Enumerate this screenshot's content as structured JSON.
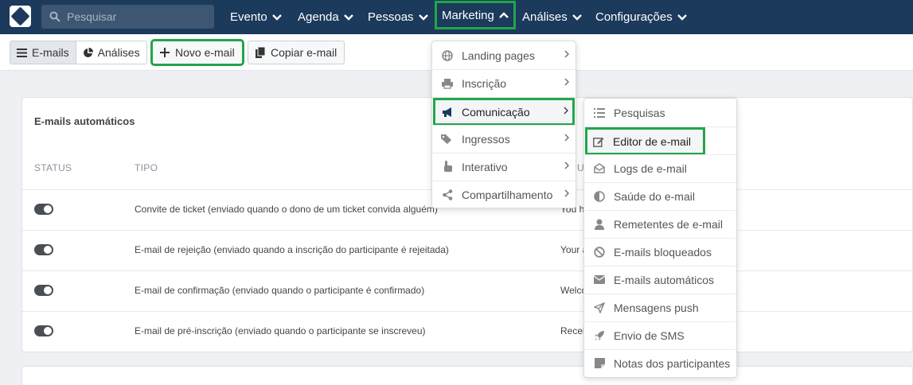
{
  "nav": {
    "search_placeholder": "Pesquisar",
    "items": [
      {
        "label": "Evento"
      },
      {
        "label": "Agenda"
      },
      {
        "label": "Pessoas"
      },
      {
        "label": "Marketing"
      },
      {
        "label": "Análises"
      },
      {
        "label": "Configurações"
      }
    ]
  },
  "toolbar": {
    "emails_label": "E-mails",
    "analises_label": "Análises",
    "novo_label": "Novo e-mail",
    "copiar_label": "Copiar e-mail"
  },
  "card": {
    "title": "E-mails automáticos",
    "col_status": "STATUS",
    "col_tipo": "TIPO",
    "col_assunto": "U",
    "rows": [
      {
        "tipo": "Convite de ticket (enviado quando o dono de um ticket convida alguém)",
        "assunto": "You h"
      },
      {
        "tipo": "E-mail de rejeição (enviado quando a inscrição do participante é rejeitada)",
        "assunto": "Your a"
      },
      {
        "tipo": "E-mail de confirmação (enviado quando o participante é confirmado)",
        "assunto": "Welco"
      },
      {
        "tipo": "E-mail de pré-inscrição (enviado quando o participante se inscreveu)",
        "assunto": "Receb"
      }
    ]
  },
  "marketing_menu": [
    {
      "label": "Landing pages",
      "icon": "globe-icon"
    },
    {
      "label": "Inscrição",
      "icon": "printer-icon"
    },
    {
      "label": "Comunicação",
      "icon": "megaphone-icon"
    },
    {
      "label": "Ingressos",
      "icon": "tags-icon"
    },
    {
      "label": "Interativo",
      "icon": "pointer-hand-icon"
    },
    {
      "label": "Compartilhamento",
      "icon": "share-icon"
    }
  ],
  "comunicacao_menu": [
    {
      "label": "Pesquisas",
      "icon": "list-icon"
    },
    {
      "label": "Editor de e-mail",
      "icon": "edit-icon"
    },
    {
      "label": "Logs de e-mail",
      "icon": "envelope-open-icon"
    },
    {
      "label": "Saúde do e-mail",
      "icon": "half-circle-icon"
    },
    {
      "label": "Remetentes de e-mail",
      "icon": "user-icon"
    },
    {
      "label": "E-mails bloqueados",
      "icon": "ban-icon"
    },
    {
      "label": "E-mails automáticos",
      "icon": "envelope-icon"
    },
    {
      "label": "Mensagens push",
      "icon": "paper-plane-icon"
    },
    {
      "label": "Envio de SMS",
      "icon": "rocket-icon"
    },
    {
      "label": "Notas dos participantes",
      "icon": "sticky-note-icon"
    }
  ],
  "colors": {
    "nav_bg": "#1b3a5c",
    "highlight": "#22a64a"
  }
}
